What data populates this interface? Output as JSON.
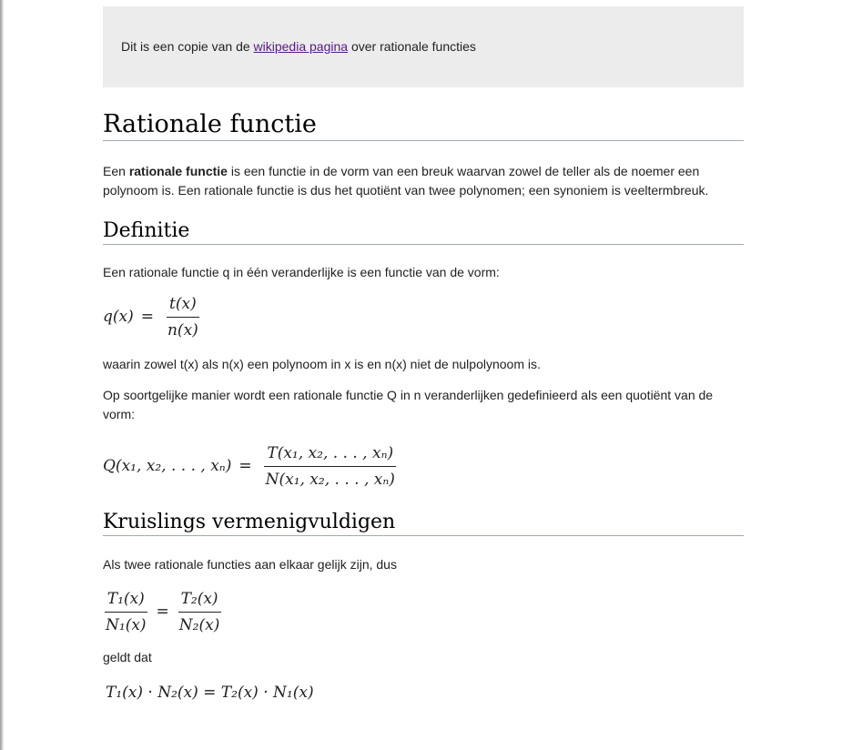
{
  "notice": {
    "text_before": "Dit is een copie van de ",
    "link_text": "wikipedia pagina",
    "text_after": " over rationale functies"
  },
  "title": "Rationale functie",
  "intro": {
    "before_bold": "Een ",
    "bold": "rationale functie",
    "after_bold": " is een functie in de vorm van een breuk waarvan zowel de teller als de noemer een polynoom is. Een rationale functie is dus het quotiënt van twee polynomen; een synoniem is veeltermbreuk."
  },
  "section_definitie": {
    "heading": "Definitie",
    "para1": "Een rationale functie q in één veranderlijke is een functie van de vorm:",
    "formula1": {
      "lhs": "q(x)",
      "eq": "=",
      "numerator": "t(x)",
      "denominator": "n(x)"
    },
    "para2": "waarin zowel t(x) als n(x) een polynoom in x is en n(x) niet de nulpolynoom is.",
    "para3": "Op soortgelijke manier wordt een rationale functie Q in n veranderlijken gedefinieerd als een quotiënt van de vorm:",
    "formula2": {
      "lhs": "Q(x₁, x₂, . . . , xₙ)",
      "eq": "=",
      "numerator": "T(x₁, x₂, . . . , xₙ)",
      "denominator": "N(x₁, x₂, . . . , xₙ)"
    }
  },
  "section_kruislings": {
    "heading": "Kruislings vermenigvuldigen",
    "para1": "Als twee rationale functies aan elkaar gelijk zijn, dus",
    "formula3": {
      "left_numerator": "T₁(x)",
      "left_denominator": "N₁(x)",
      "eq": "=",
      "right_numerator": "T₂(x)",
      "right_denominator": "N₂(x)"
    },
    "para2": "geldt dat",
    "formula4": "T₁(x) · N₂(x) = T₂(x) · N₁(x)"
  }
}
